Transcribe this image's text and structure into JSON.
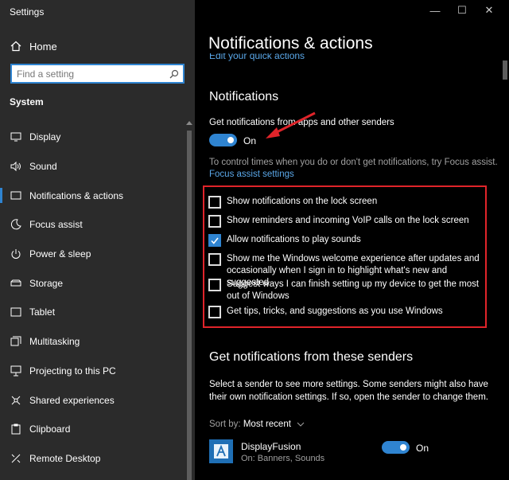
{
  "window": {
    "title": "Settings",
    "controls": [
      "—",
      "☐",
      "✕"
    ]
  },
  "sidebar": {
    "home_label": "Home",
    "search_placeholder": "Find a setting",
    "section_label": "System",
    "items": [
      {
        "label": "Display",
        "icon": "display-icon",
        "active": false
      },
      {
        "label": "Sound",
        "icon": "sound-icon",
        "active": false
      },
      {
        "label": "Notifications & actions",
        "icon": "notifications-icon",
        "active": true
      },
      {
        "label": "Focus assist",
        "icon": "moon-icon",
        "active": false
      },
      {
        "label": "Power & sleep",
        "icon": "power-icon",
        "active": false
      },
      {
        "label": "Storage",
        "icon": "storage-icon",
        "active": false
      },
      {
        "label": "Tablet",
        "icon": "tablet-icon",
        "active": false
      },
      {
        "label": "Multitasking",
        "icon": "multitasking-icon",
        "active": false
      },
      {
        "label": "Projecting to this PC",
        "icon": "projecting-icon",
        "active": false
      },
      {
        "label": "Shared experiences",
        "icon": "shared-experiences-icon",
        "active": false
      },
      {
        "label": "Clipboard",
        "icon": "clipboard-icon",
        "active": false
      },
      {
        "label": "Remote Desktop",
        "icon": "remote-desktop-icon",
        "active": false
      }
    ]
  },
  "main": {
    "page_title": "Notifications & actions",
    "quick_actions_link": "Edit your quick actions",
    "notifications_heading": "Notifications",
    "get_notifications_label": "Get notifications from apps and other senders",
    "get_notifications_state": "On",
    "focus_info": "To control times when you do or don't get notifications, try Focus assist.",
    "focus_link": "Focus assist settings",
    "checkboxes": [
      {
        "label": "Show notifications on the lock screen",
        "checked": false
      },
      {
        "label": "Show reminders and incoming VoIP calls on the lock screen",
        "checked": false
      },
      {
        "label": "Allow notifications to play sounds",
        "checked": true
      },
      {
        "label": "Show me the Windows welcome experience after updates and occasionally when I sign in to highlight what's new and suggested",
        "checked": false
      },
      {
        "label": "Suggest ways I can finish setting up my device to get the most out of Windows",
        "checked": false
      },
      {
        "label": "Get tips, tricks, and suggestions as you use Windows",
        "checked": false
      }
    ],
    "senders_heading": "Get notifications from these senders",
    "senders_desc": "Select a sender to see more settings. Some senders might also have their own notification settings. If so, open the sender to change them.",
    "sort_label": "Sort by:",
    "sort_value": "Most recent",
    "senders": [
      {
        "name": "DisplayFusion",
        "detail": "On: Banners, Sounds",
        "state": "On"
      }
    ]
  },
  "colors": {
    "accent": "#2f84d1",
    "highlight_box": "#e0242a",
    "sidebar_bg": "#2b2b2b",
    "main_bg": "#000000",
    "link": "#5aa7e8"
  }
}
